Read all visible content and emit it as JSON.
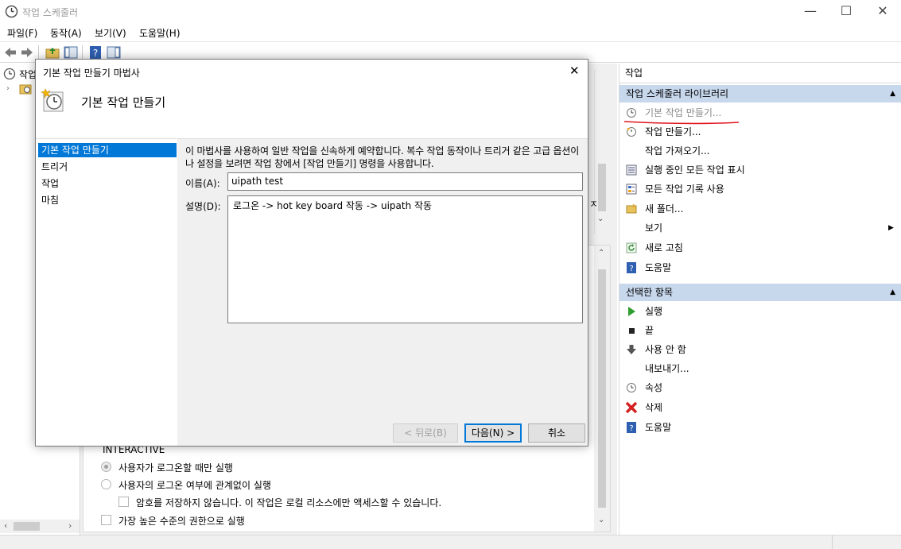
{
  "window": {
    "title": "작업 스케줄러",
    "minimize": "—",
    "maximize": "☐",
    "close": "✕"
  },
  "menu": [
    "파일(F)",
    "동작(A)",
    "보기(V)",
    "도움말(H)"
  ],
  "tree": {
    "root_label": "작업"
  },
  "dialog": {
    "title": "기본 작업 만들기 마법사",
    "close": "✕",
    "heading": "기본 작업 만들기",
    "steps": [
      "기본 작업 만들기",
      "트리거",
      "작업",
      "마침"
    ],
    "intro": "이 마법사를 사용하여 일반 작업을 신속하게 예약합니다. 복수 작업 동작이나 트리거 같은 고급 옵션이나 설정을 보려면 작업 창에서 [작업 만들기] 명령을 사용합니다.",
    "name_label": "이름(A):",
    "name_value": "uipath test",
    "desc_label": "설명(D):",
    "desc_value": "로그온 -> hot key board 작동 -> uipath 작동",
    "back_btn": "< 뒤로(B)",
    "next_btn": "다음(N) >",
    "cancel_btn": "취소"
  },
  "center_behind": {
    "interactive": "INTERACTIVE",
    "radio1": "사용자가 로그온할 때만 실행",
    "radio2": "사용자의 로그온 여부에 관계없이 실행",
    "check1": "암호를 저장하지 않습니다. 이 작업은 로컬 리소스에만 액세스할 수 있습니다.",
    "check2": "가장 높은 수준의 권한으로 실행",
    "partial_char": "ㅈ"
  },
  "actions": {
    "header": "작업",
    "section1": "작업 스케줄러 라이브러리",
    "items1": [
      {
        "label": "기본 작업 만들기...",
        "icon": "clock-wizard-icon"
      },
      {
        "label": "작업 만들기...",
        "icon": "clock-icon"
      },
      {
        "label": "작업 가져오기...",
        "icon": ""
      },
      {
        "label": "실행 중인 모든 작업 표시",
        "icon": "list-icon"
      },
      {
        "label": "모든 작업 기록 사용",
        "icon": "history-icon"
      },
      {
        "label": "새 폴더...",
        "icon": "folder-icon"
      },
      {
        "label": "보기",
        "icon": ""
      },
      {
        "label": "새로 고침",
        "icon": "refresh-icon"
      },
      {
        "label": "도움말",
        "icon": "help-icon"
      }
    ],
    "section2": "선택한 항목",
    "items2": [
      {
        "label": "실행",
        "icon": "play-icon"
      },
      {
        "label": "끝",
        "icon": "stop-icon"
      },
      {
        "label": "사용 안 함",
        "icon": "disable-icon"
      },
      {
        "label": "내보내기...",
        "icon": ""
      },
      {
        "label": "속성",
        "icon": "properties-icon"
      },
      {
        "label": "삭제",
        "icon": "delete-icon"
      },
      {
        "label": "도움말",
        "icon": "help-icon"
      }
    ]
  },
  "colors": {
    "accent": "#0078d7",
    "section_bg": "#c7d7ec",
    "annotation_red": "#e0141e"
  }
}
